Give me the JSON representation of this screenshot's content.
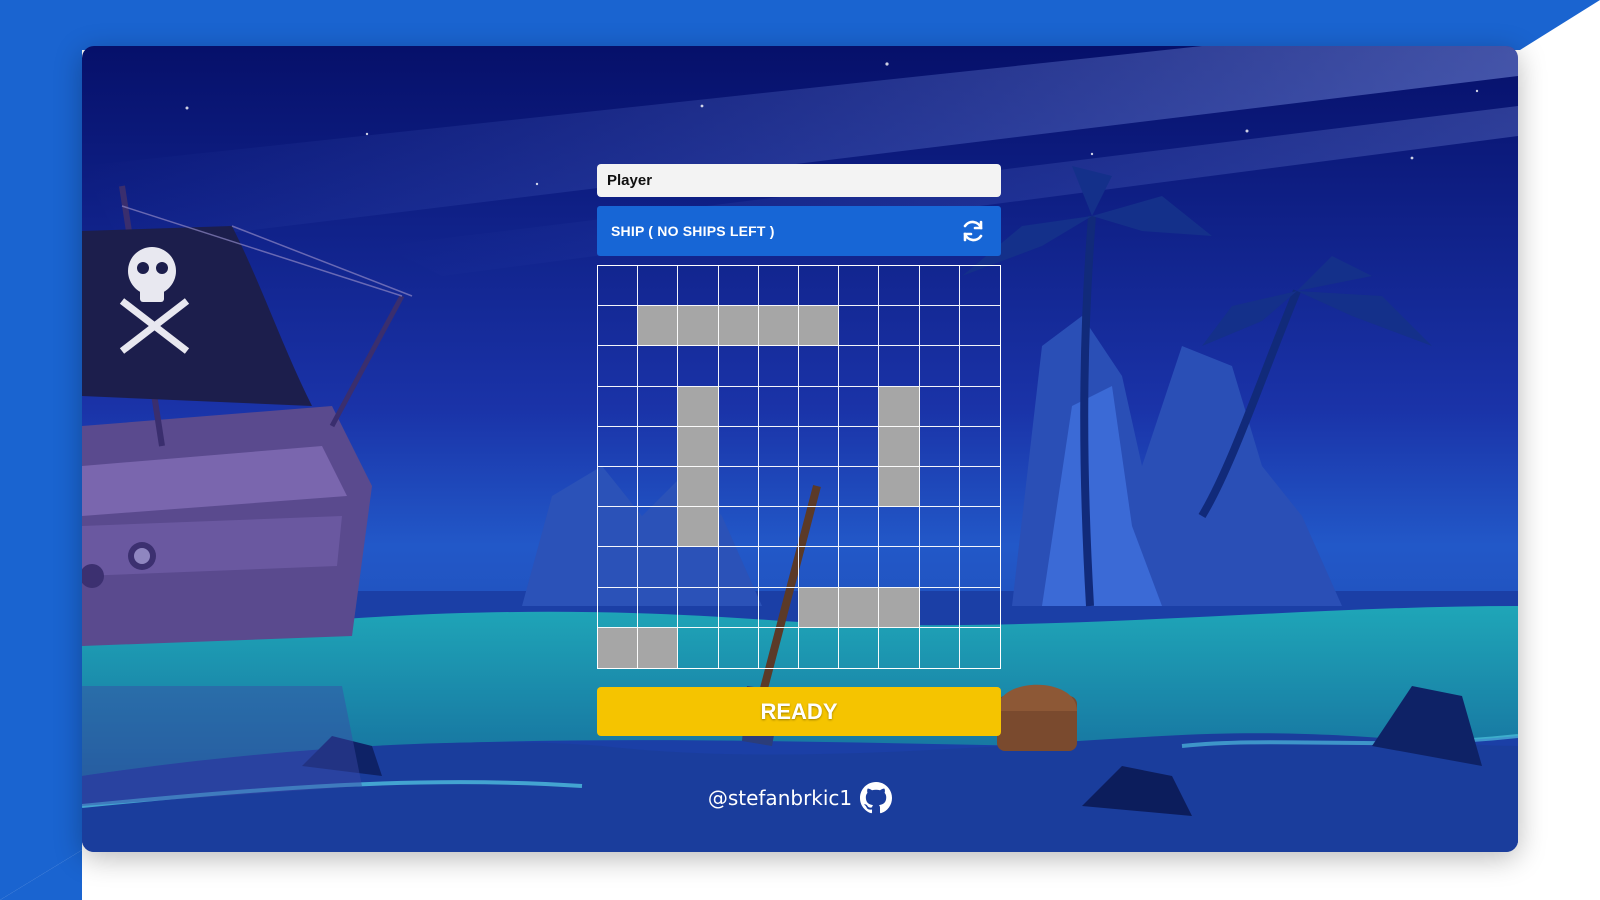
{
  "player": {
    "name_value": "Player"
  },
  "ship_selector": {
    "label": "SHIP ( NO SHIPS LEFT )",
    "refresh_icon": "refresh-icon"
  },
  "board": {
    "rows": 10,
    "cols": 10,
    "occupied_cells": [
      [
        1,
        1
      ],
      [
        1,
        2
      ],
      [
        1,
        3
      ],
      [
        1,
        4
      ],
      [
        1,
        5
      ],
      [
        3,
        2
      ],
      [
        4,
        2
      ],
      [
        5,
        2
      ],
      [
        6,
        2
      ],
      [
        3,
        7
      ],
      [
        4,
        7
      ],
      [
        5,
        7
      ],
      [
        8,
        5
      ],
      [
        8,
        6
      ],
      [
        8,
        7
      ],
      [
        9,
        0
      ],
      [
        9,
        1
      ]
    ],
    "ship_color": "#a6a6a6",
    "grid_line_color": "#ffffff"
  },
  "ready_button": {
    "label": "READY",
    "color": "#f5c400"
  },
  "footer": {
    "handle": "@stefanbrkic1",
    "icon": "github-icon"
  },
  "colors": {
    "accent": "#1766d6",
    "page_background": "#1a64d0"
  }
}
